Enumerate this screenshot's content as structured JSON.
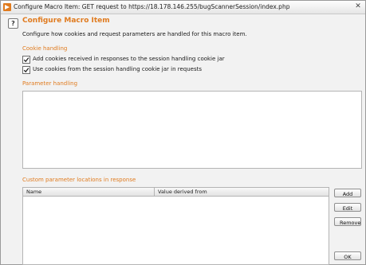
{
  "window": {
    "title": "Configure Macro Item: GET request to https://18.178.146.255/bugScannerSession/index.php",
    "close_glyph": "✕"
  },
  "header": {
    "help_glyph": "?",
    "title": "Configure Macro Item",
    "description": "Configure how cookies and request parameters are handled for this macro item."
  },
  "cookie_handling": {
    "label": "Cookie handling",
    "options": [
      {
        "label": "Add cookies received in responses to the session handling cookie jar",
        "checked": true
      },
      {
        "label": "Use cookies from the session handling cookie jar in requests",
        "checked": true
      }
    ]
  },
  "parameter_handling": {
    "label": "Parameter handling"
  },
  "custom_params": {
    "label": "Custom parameter locations in response",
    "columns": [
      "Name",
      "Value derived from"
    ],
    "rows": []
  },
  "buttons": {
    "add": "Add",
    "edit": "Edit",
    "remove": "Remove",
    "ok": "OK"
  },
  "colors": {
    "accent": "#e07b1f"
  },
  "icons": {
    "app": "burp-app-icon",
    "help": "help-icon",
    "checkmark": "checkmark-icon",
    "close": "close-icon"
  }
}
